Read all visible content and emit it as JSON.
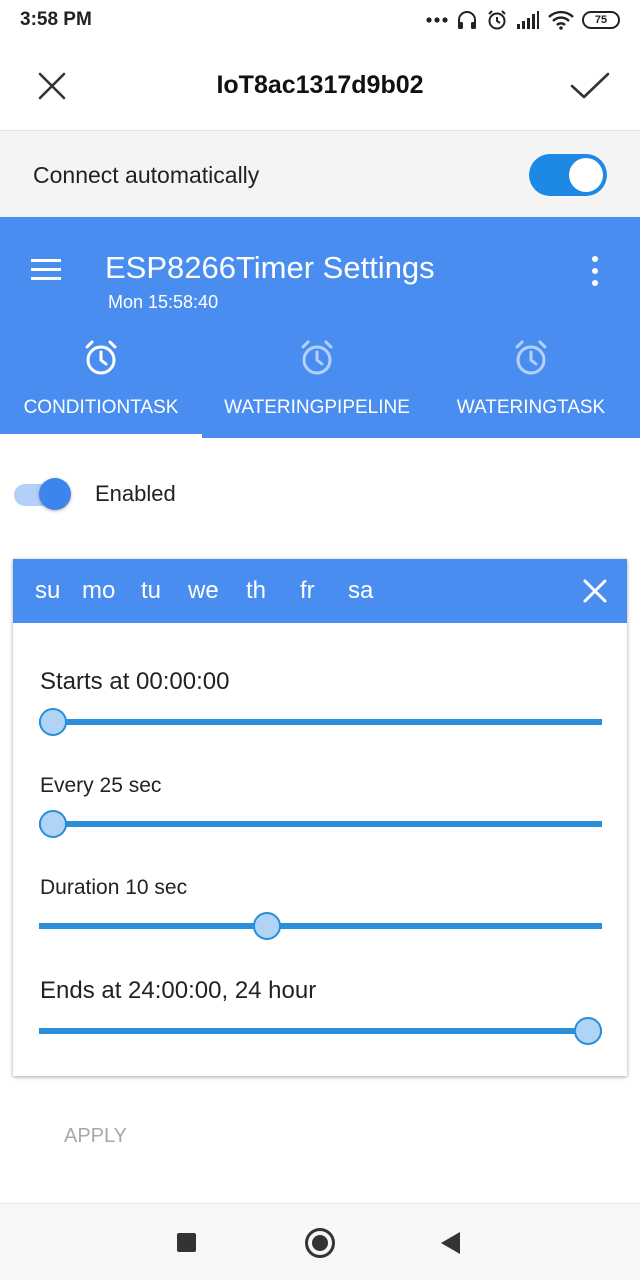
{
  "status_bar": {
    "time": "3:58 PM",
    "battery": "75",
    "icons": [
      "more-dots-icon",
      "headset-icon",
      "alarm-icon",
      "signal-icon",
      "wifi-icon",
      "battery-icon"
    ]
  },
  "dialog": {
    "title": "IoT8ac1317d9b02",
    "close_icon": "close-icon",
    "confirm_icon": "check-icon"
  },
  "connect": {
    "label": "Connect automatically",
    "enabled": true
  },
  "appbar": {
    "title": "ESP8266Timer Settings",
    "subtitle": "Mon 15:58:40",
    "menu_icon": "menu-icon",
    "more_icon": "more-vert-icon",
    "tabs": [
      {
        "label": "CONDITIONTASK",
        "icon": "alarm-icon",
        "active": true
      },
      {
        "label": "WATERINGPIPELINE",
        "icon": "alarm-icon",
        "active": false
      },
      {
        "label": "WATERINGTASK",
        "icon": "alarm-icon",
        "active": false
      }
    ]
  },
  "task": {
    "enabled_label": "Enabled",
    "enabled": true
  },
  "card": {
    "days": [
      "su",
      "mo",
      "tu",
      "we",
      "th",
      "fr",
      "sa"
    ],
    "close_icon": "close-icon",
    "sliders": [
      {
        "label": "Starts at 00:00:00",
        "value_fraction": 0.0
      },
      {
        "label": "Every 25 sec",
        "value_fraction": 0.0
      },
      {
        "label": "Duration 10 sec",
        "value_fraction": 0.4
      },
      {
        "label": "Ends at 24:00:00, 24 hour",
        "value_fraction": 1.0
      }
    ]
  },
  "apply_label": "APPLY",
  "navbar": {
    "recents_icon": "square-icon",
    "home_icon": "home-circle-icon",
    "back_icon": "back-triangle-icon"
  },
  "colors": {
    "primary": "#4a8df0",
    "toggle_on": "#1e88e5",
    "slider": "#2a8ed8",
    "slider_thumb": "#b0d4f5",
    "apply_disabled": "#a8a8a8"
  }
}
